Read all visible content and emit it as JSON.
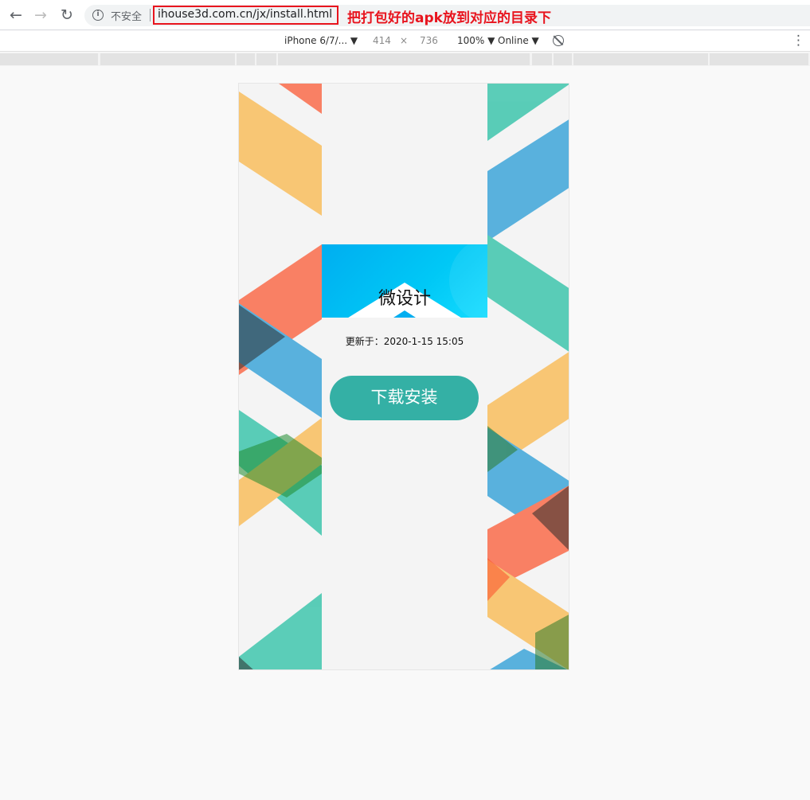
{
  "browser": {
    "back": "←",
    "forward": "→",
    "reload": "↻",
    "info": "i",
    "security_label": "不安全",
    "url": "ihouse3d.com.cn/jx/install.html",
    "annotation": "把打包好的apk放到对应的目录下"
  },
  "device_toolbar": {
    "device": "iPhone 6/7/... ▼",
    "width": "414",
    "times": "×",
    "height": "736",
    "zoom": "100% ▼",
    "network": "Online ▼",
    "more": "⋮"
  },
  "page": {
    "app_name": "微设计",
    "updated": "更新于：2020-1-15 15:05",
    "download_label": "下载安装",
    "accent_color": "#34b0a5"
  }
}
